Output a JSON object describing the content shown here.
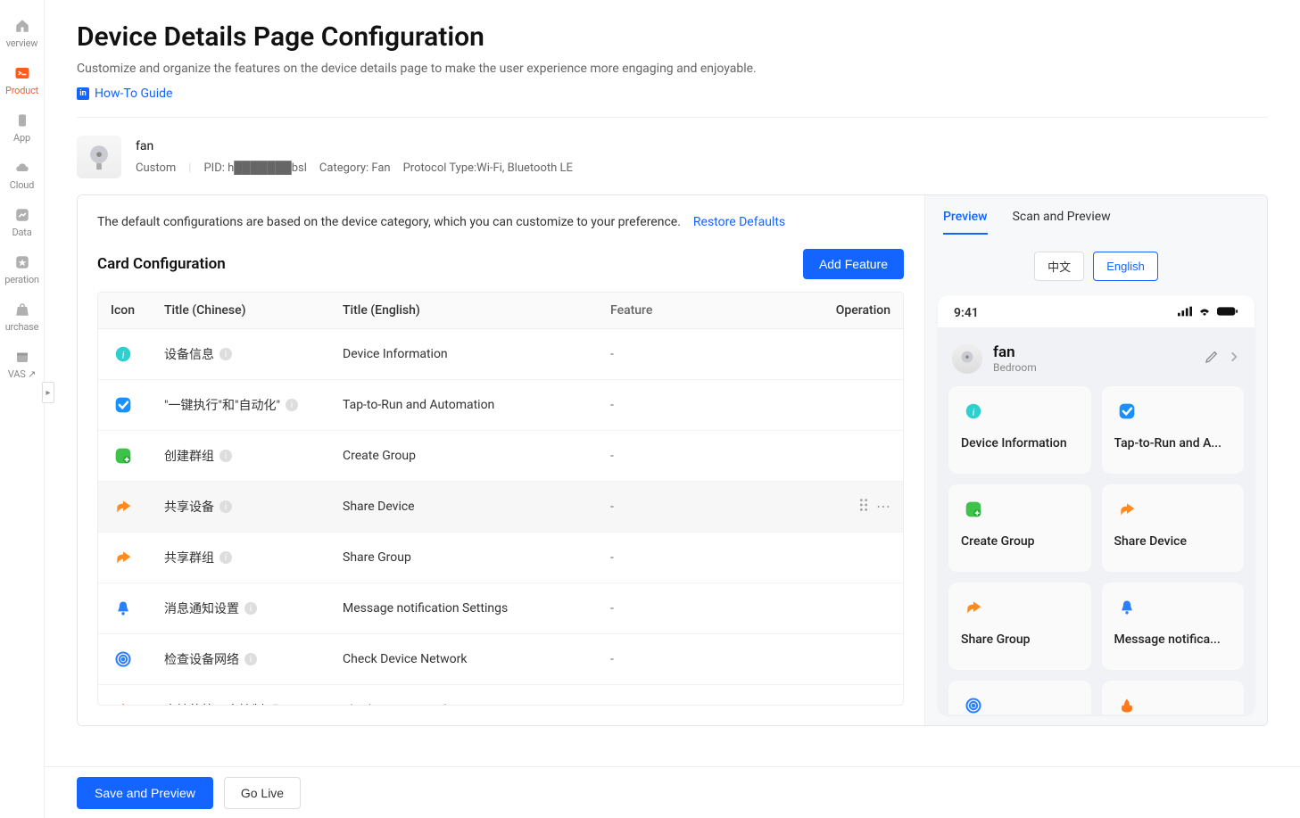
{
  "sidebar": {
    "items": [
      {
        "label": "verview",
        "icon": "home"
      },
      {
        "label": "Product",
        "icon": "terminal",
        "active": true
      },
      {
        "label": "App",
        "icon": "phone"
      },
      {
        "label": "Cloud",
        "icon": "cloud"
      },
      {
        "label": "Data",
        "icon": "chart"
      },
      {
        "label": "peration",
        "icon": "star"
      },
      {
        "label": "urchase",
        "icon": "bag"
      },
      {
        "label": "VAS ↗",
        "icon": "box"
      }
    ]
  },
  "page": {
    "title": "Device Details Page Configuration",
    "desc": "Customize and organize the features on the device details page to make the user experience more engaging and enjoyable.",
    "howto": "How-To Guide"
  },
  "product": {
    "name": "fan",
    "custom_label": "Custom",
    "pid_label": "PID: h███████bsl",
    "category_label": "Category: Fan",
    "protocol_label": "Protocol Type:Wi-Fi, Bluetooth LE"
  },
  "note": {
    "text": "The default configurations are based on the device category, which you can customize to your preference.",
    "restore": "Restore Defaults"
  },
  "section": {
    "title": "Card Configuration",
    "add_feature": "Add Feature"
  },
  "table": {
    "headers": {
      "icon": "Icon",
      "title_cn": "Title (Chinese)",
      "title_en": "Title (English)",
      "feature": "Feature",
      "operation": "Operation"
    },
    "rows": [
      {
        "icon": "info",
        "title_cn": "设备信息",
        "title_en": "Device Information",
        "feature": "-",
        "hover": false,
        "color": "#2dd0cf"
      },
      {
        "icon": "check",
        "title_cn": "\"一键执行\"和\"自动化\"",
        "title_en": "Tap-to-Run and Automation",
        "feature": "-",
        "hover": false,
        "color": "#1a90ff"
      },
      {
        "icon": "group",
        "title_cn": "创建群组",
        "title_en": "Create Group",
        "feature": "-",
        "hover": false,
        "color": "#3ec24a"
      },
      {
        "icon": "share",
        "title_cn": "共享设备",
        "title_en": "Share Device",
        "feature": "-",
        "hover": true,
        "color": "#ff8a1e"
      },
      {
        "icon": "share",
        "title_cn": "共享群组",
        "title_en": "Share Group",
        "feature": "-",
        "hover": false,
        "color": "#ff8a1e"
      },
      {
        "icon": "bell",
        "title_cn": "消息通知设置",
        "title_en": "Message notification Settings",
        "feature": "-",
        "hover": false,
        "color": "#2b7fff"
      },
      {
        "icon": "network",
        "title_cn": "检查设备网络",
        "title_en": "Check Device Network",
        "feature": "-",
        "hover": false,
        "color": "#2b7fff"
      },
      {
        "icon": "flame",
        "title_cn": "支持的第三方控制",
        "title_en": "Third-party Control",
        "feature": "-",
        "hover": false,
        "color": "#ff7a1a"
      }
    ]
  },
  "right": {
    "tabs": {
      "preview": "Preview",
      "scan": "Scan and Preview"
    },
    "lang": {
      "cn": "中文",
      "en": "English"
    },
    "phone": {
      "time": "9:41",
      "title": "fan",
      "room": "Bedroom",
      "cards": [
        {
          "icon": "info",
          "label": "Device Information",
          "color": "#2dd0cf"
        },
        {
          "icon": "check",
          "label": "Tap-to-Run and A...",
          "color": "#1a90ff"
        },
        {
          "icon": "group",
          "label": "Create Group",
          "color": "#3ec24a"
        },
        {
          "icon": "share",
          "label": "Share Device",
          "color": "#ff8a1e"
        },
        {
          "icon": "share",
          "label": "Share Group",
          "color": "#ff8a1e"
        },
        {
          "icon": "bell",
          "label": "Message notifica...",
          "color": "#2b7fff"
        },
        {
          "icon": "network",
          "label": "",
          "color": "#2b7fff"
        },
        {
          "icon": "flame",
          "label": "",
          "color": "#ff7a1a"
        }
      ]
    }
  },
  "bottom": {
    "save_preview": "Save and Preview",
    "go_live": "Go Live"
  }
}
